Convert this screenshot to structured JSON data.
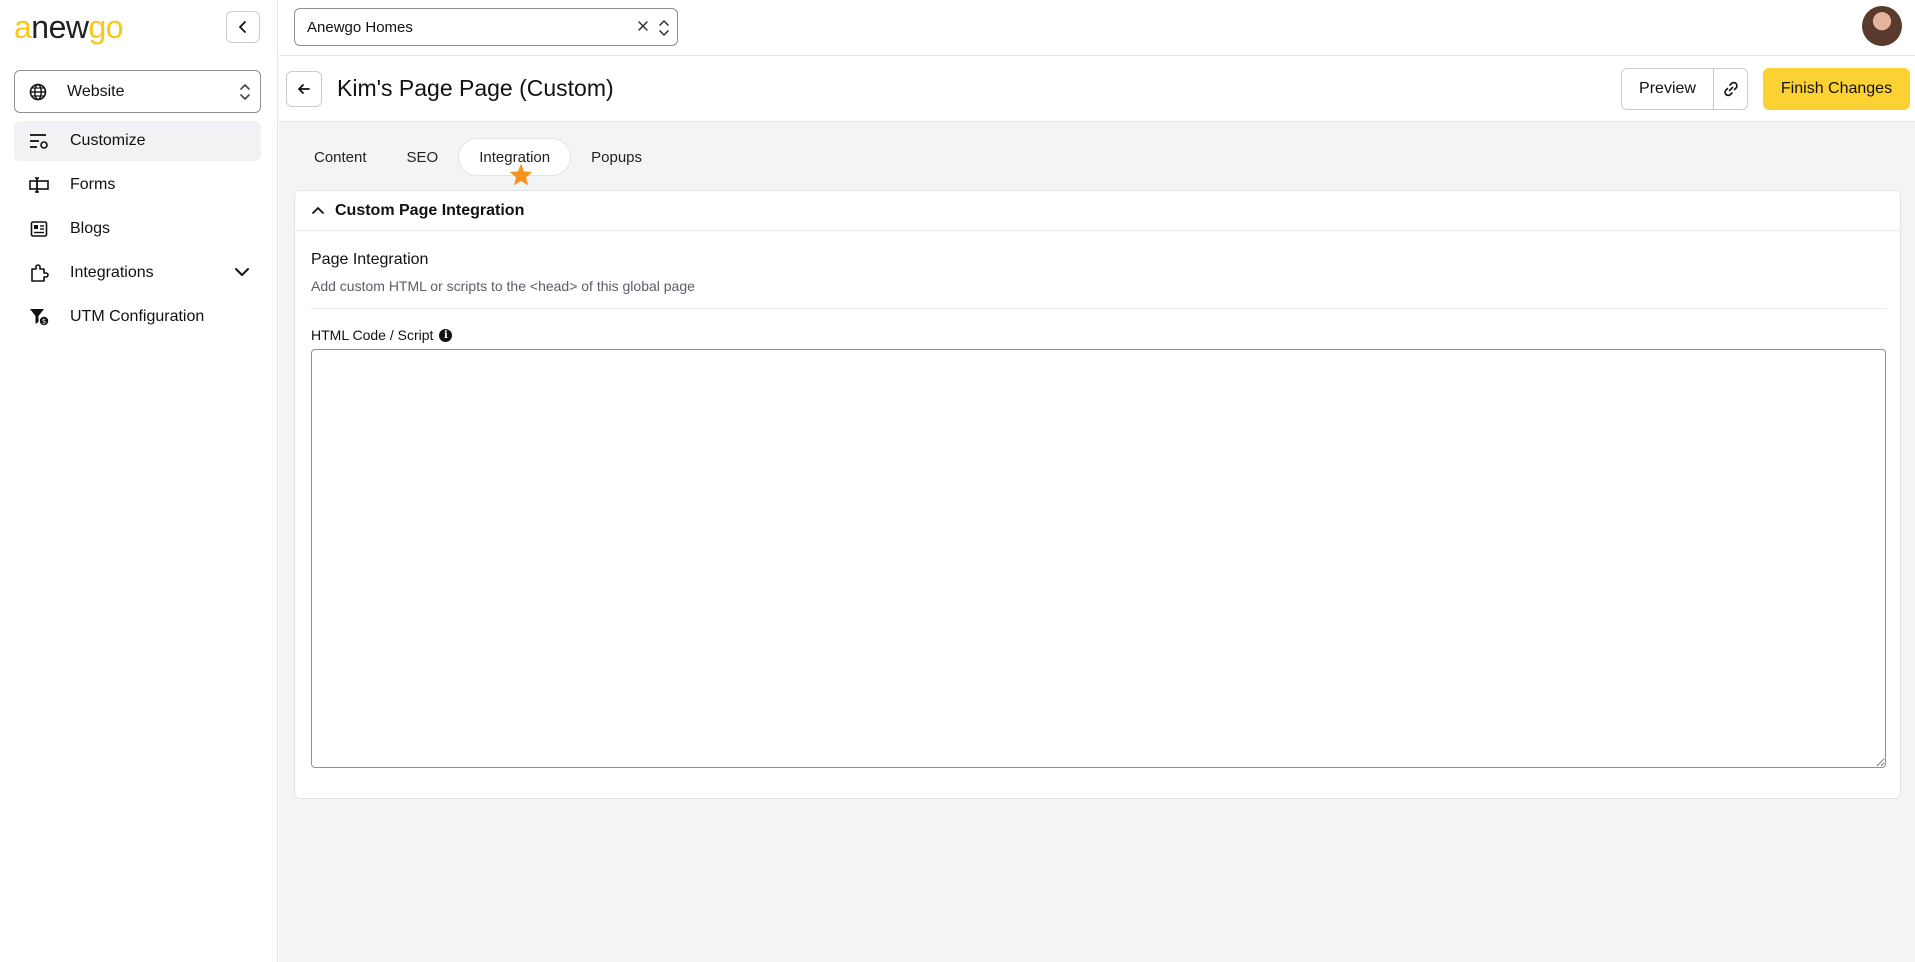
{
  "logo": {
    "part1": "a",
    "part2": "new",
    "part3": "go"
  },
  "sidebar": {
    "site_selector": {
      "label": "Website",
      "icon": "globe-icon"
    },
    "items": [
      {
        "label": "Customize",
        "icon": "customize-sliders-icon",
        "active": true
      },
      {
        "label": "Forms",
        "icon": "form-input-icon"
      },
      {
        "label": "Blogs",
        "icon": "newspaper-icon"
      },
      {
        "label": "Integrations",
        "icon": "puzzle-icon",
        "expandable": true
      },
      {
        "label": "UTM Configuration",
        "icon": "funnel-dollar-icon"
      }
    ]
  },
  "topbar": {
    "organization": "Anewgo Homes"
  },
  "page": {
    "title": "Kim's Page Page (Custom)",
    "preview_label": "Preview",
    "finish_label": "Finish Changes"
  },
  "tabs": [
    {
      "label": "Content"
    },
    {
      "label": "SEO"
    },
    {
      "label": "Integration",
      "active": true
    },
    {
      "label": "Popups"
    }
  ],
  "card": {
    "header": "Custom Page Integration",
    "section_title": "Page Integration",
    "section_desc": "Add custom HTML or scripts to the <head> of this global page",
    "field_label": "HTML Code / Script",
    "field_value": ""
  },
  "colors": {
    "accent_yellow": "#fcd232",
    "logo_yellow": "#f6c918",
    "star_orange": "#f7941d",
    "background": "#f3f4f6"
  }
}
